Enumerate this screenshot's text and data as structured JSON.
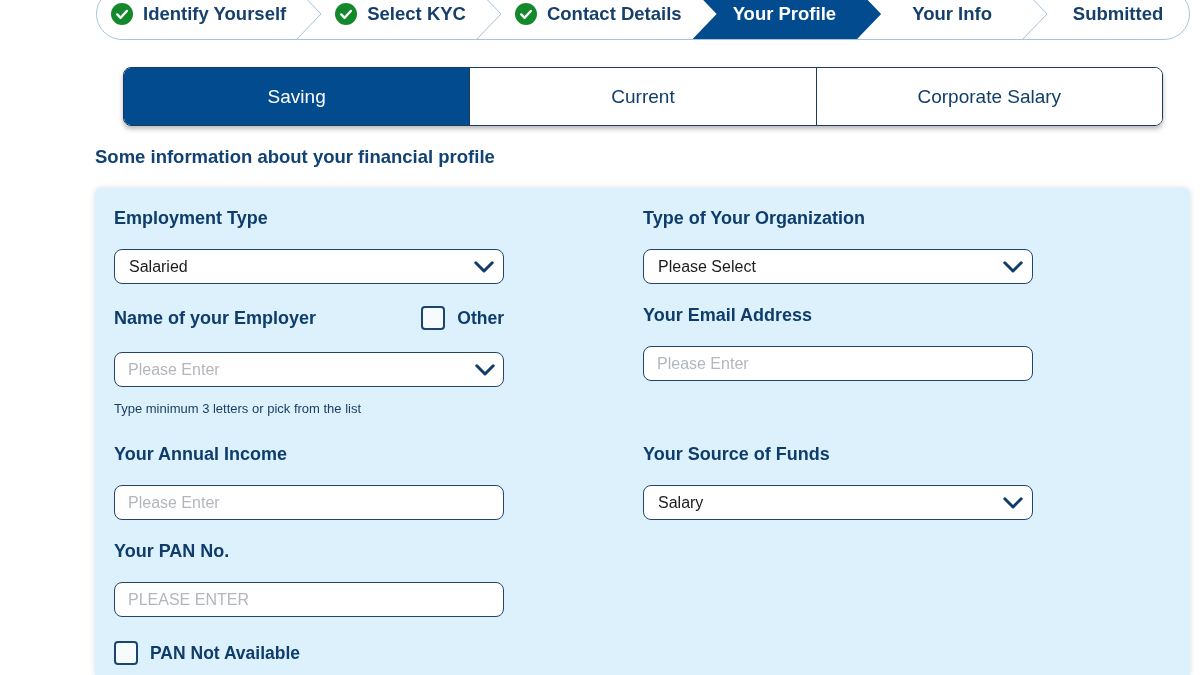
{
  "stepper": {
    "steps": [
      {
        "label": "Identify Yourself",
        "completed": true,
        "selected": false
      },
      {
        "label": "Select KYC",
        "completed": true,
        "selected": false
      },
      {
        "label": "Contact Details",
        "completed": true,
        "selected": false
      },
      {
        "label": "Your Profile",
        "completed": false,
        "selected": true
      },
      {
        "label": "Your Info",
        "completed": false,
        "selected": false
      },
      {
        "label": "Submitted",
        "completed": false,
        "selected": false
      }
    ]
  },
  "account_tabs": [
    {
      "label": "Saving",
      "selected": true
    },
    {
      "label": "Current",
      "selected": false
    },
    {
      "label": "Corporate Salary",
      "selected": false
    }
  ],
  "section_title": "Some information about your financial profile",
  "form": {
    "rows": [
      [
        {
          "kind": "select",
          "label": "Employment Type",
          "value": "Salaried"
        },
        {
          "kind": "select",
          "label": "Type of Your Organization",
          "value": "Please Select"
        }
      ],
      [
        {
          "kind": "combobox",
          "label": "Name of your Employer",
          "option": {
            "label": "Other",
            "checked": false
          },
          "placeholder": "Please Enter",
          "hint": "Type minimum 3 letters or pick from the list"
        },
        {
          "kind": "input",
          "label": "Your Email Address",
          "placeholder": "Please Enter"
        }
      ],
      [
        {
          "kind": "input",
          "label": "Your Annual Income",
          "placeholder": "Please Enter"
        },
        {
          "kind": "select",
          "label": "Your Source of Funds",
          "value": "Salary"
        }
      ],
      [
        {
          "kind": "input",
          "label": "Your PAN No.",
          "placeholder": "PLEASE ENTER"
        }
      ],
      [
        {
          "kind": "checkbox",
          "label": "PAN Not Available",
          "checked": false
        }
      ]
    ]
  }
}
